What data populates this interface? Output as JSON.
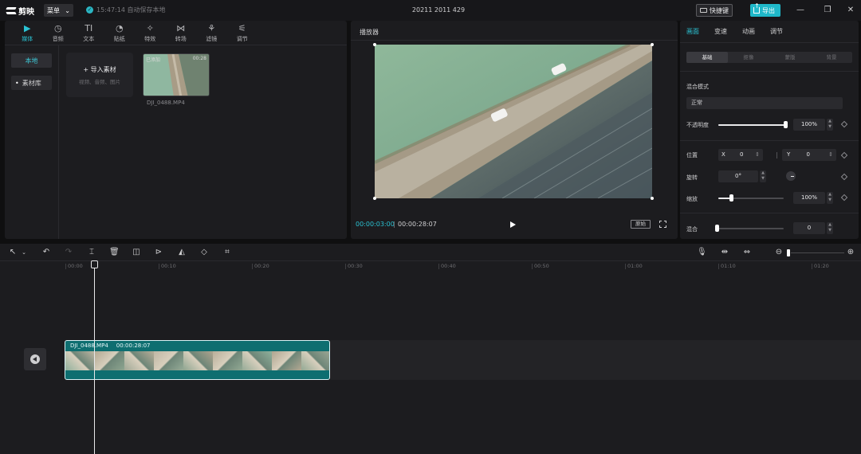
{
  "app": {
    "name": "剪映",
    "menu_label": "菜单",
    "save_status": "15:47:14 自动保存本地",
    "window_title": "20211 2011 429",
    "shortcut_label": "快捷键",
    "export_label": "导出"
  },
  "media": {
    "tabs": [
      {
        "label": "媒体",
        "icon": "media-icon",
        "glyph": "▶"
      },
      {
        "label": "音频",
        "icon": "audio-icon",
        "glyph": "◷"
      },
      {
        "label": "文本",
        "icon": "text-icon",
        "glyph": "TI"
      },
      {
        "label": "贴纸",
        "icon": "sticker-icon",
        "glyph": "◔"
      },
      {
        "label": "特效",
        "icon": "effects-icon",
        "glyph": "✧"
      },
      {
        "label": "转场",
        "icon": "transition-icon",
        "glyph": "⋈"
      },
      {
        "label": "滤镜",
        "icon": "filter-icon",
        "glyph": "⚘"
      },
      {
        "label": "调节",
        "icon": "adjust-icon",
        "glyph": "⚟"
      }
    ],
    "sidebar": {
      "local": "本地",
      "library": "素材库"
    },
    "import": {
      "title": "导入素材",
      "subtitle": "视频、音频、图片"
    },
    "clip": {
      "added": "已添加",
      "duration": "00:28",
      "name": "DJI_0488.MP4"
    }
  },
  "player": {
    "title": "播放器",
    "current_time": "00:00:03:00",
    "total_time": "00:00:28:07",
    "ratio_label": "原始"
  },
  "properties": {
    "tabs": [
      "画面",
      "变速",
      "动画",
      "调节"
    ],
    "subtabs": [
      "基础",
      "抠像",
      "蒙版",
      "背景"
    ],
    "blend_mode_label": "混合模式",
    "blend_mode_value": "正常",
    "opacity_label": "不透明度",
    "opacity_value": "100%",
    "opacity_level": 1.0,
    "position_label": "位置",
    "pos_x_label": "X",
    "pos_x": "0",
    "pos_y_label": "Y",
    "pos_y": "0",
    "rotation_label": "旋转",
    "rotation_value": "0°",
    "scale_label": "缩放",
    "scale_value": "100%",
    "scale_level": 0.2,
    "blur_label": "混合",
    "blur_value": "0",
    "blur_level": 0.0
  },
  "timeline": {
    "ruler": [
      "00:00",
      "00:10",
      "00:20",
      "00:30",
      "00:40",
      "00:50",
      "01:00",
      "01:10",
      "01:20"
    ],
    "clip_name": "DJI_0488.MP4",
    "clip_duration": "00:00:28:07"
  },
  "colors": {
    "accent": "#1fb8c9",
    "clip": "#0e6e70"
  }
}
